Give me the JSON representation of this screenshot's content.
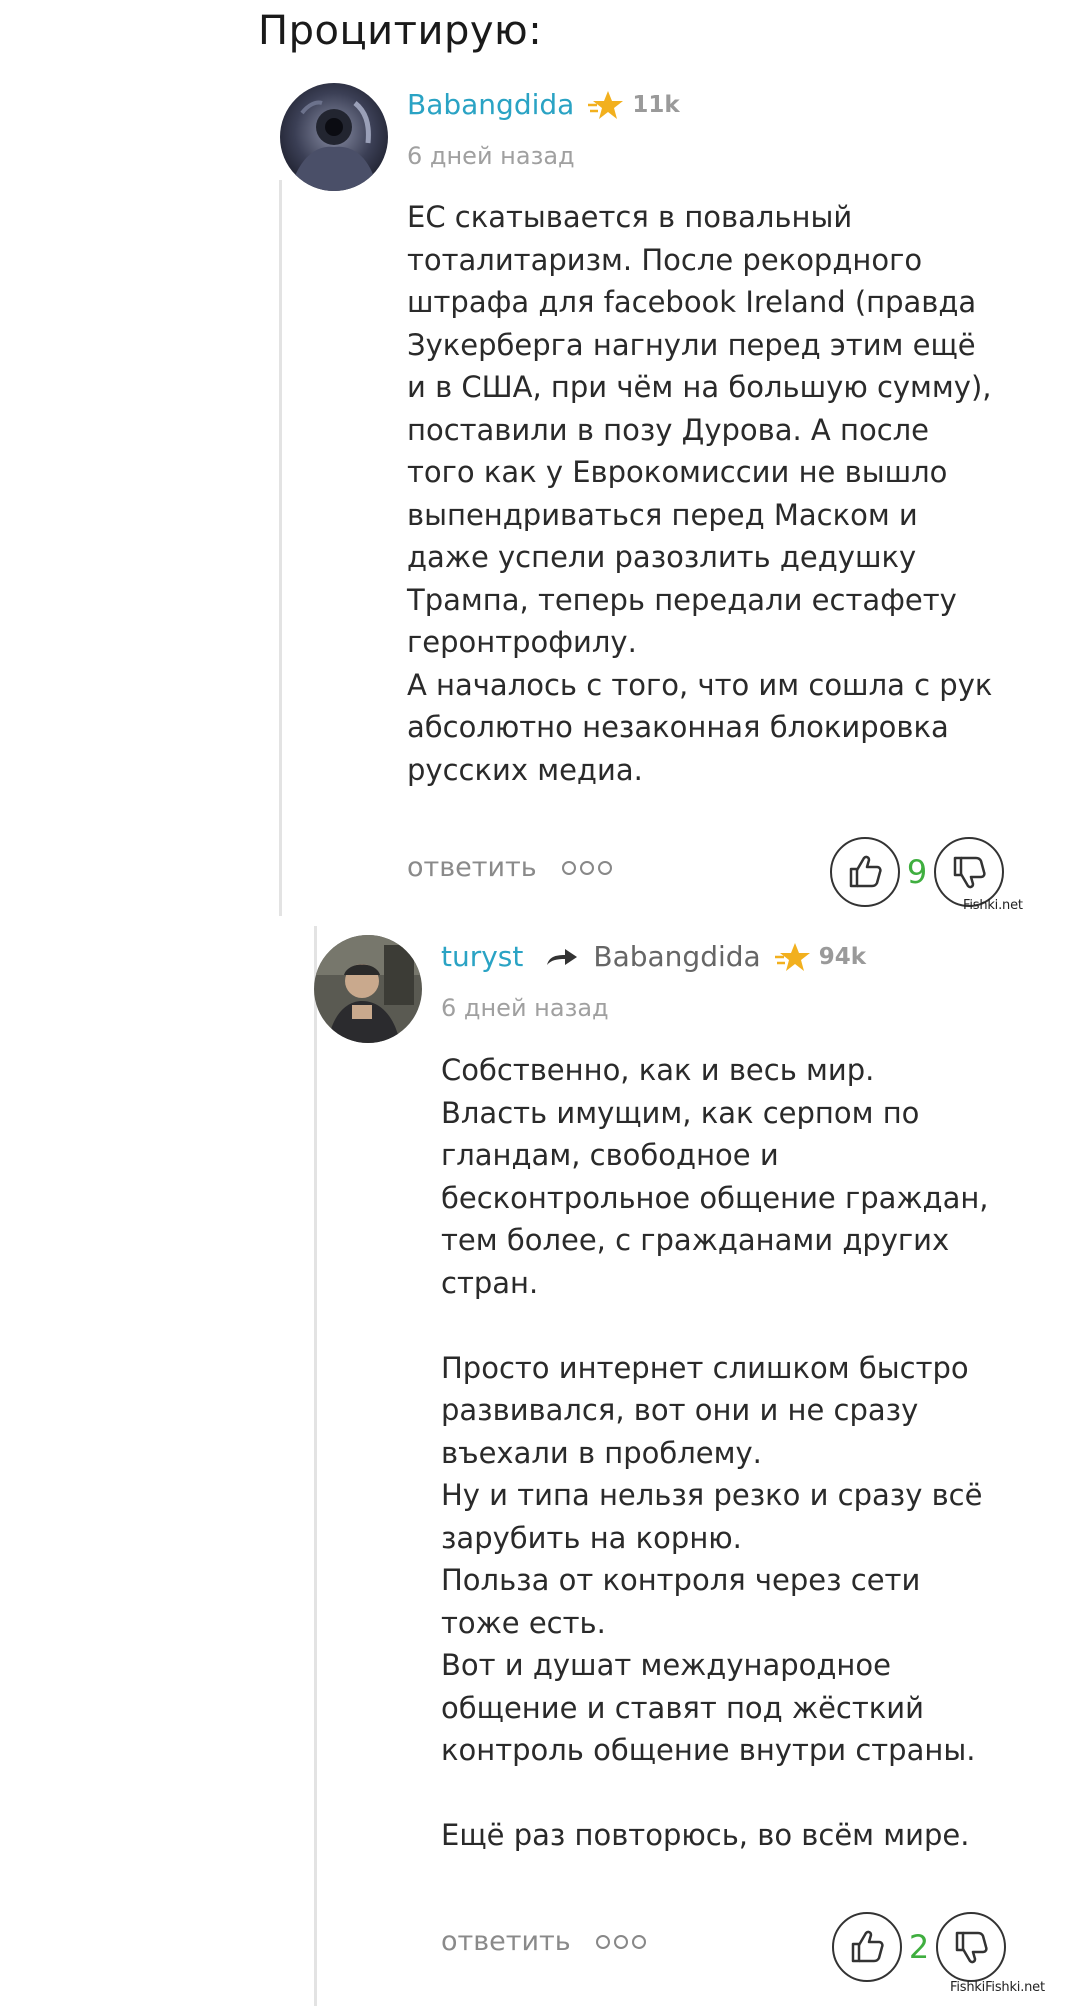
{
  "header": {
    "title": "Процитирую:"
  },
  "comments": [
    {
      "author": "Babangdida",
      "rating": "11k",
      "time": "6 дней назад",
      "body": "ЕС скатывается в повальный\nтоталитаризм. После рекордного\nштрафа для facebook Ireland (правда\nЗукерберга нагнули перед этим ещё\nи в США, при чём на большую сумму),\nпоставили в позу Дурова. А после\nтого как у Еврокомиссии не вышло\nвыпендриваться перед Маском и\nдаже успели разозлить дедушку\nТрампа, теперь передали естафету\nгеронтрофилу.\nА началось с того, что им сошла с рук\nабсолютно незаконная блокировка\nрусских медиа.",
      "reply_label": "ответить",
      "votes": "9"
    },
    {
      "author": "turyst",
      "reply_to": "Babangdida",
      "rating": "94k",
      "time": "6 дней назад",
      "body": "Собственно, как и весь мир.\nВласть имущим, как серпом по\nгландам, свободное и\nбесконтрольное общение граждан,\nтем более, с гражданами других\nстран.\n\nПросто интернет слишком быстро\nразвивался, вот они и не сразу\nвъехали в проблему.\nНу и типа нельзя резко и сразу всё\nзарубить на корню.\nПольза от контроля через сети\nтоже есть.\nВот и душат международное\nобщение и ставят под жёсткий\nконтроль общение внутри страны.\n\nЕщё раз повторюсь, во всём мире.",
      "reply_label": "ответить",
      "votes": "2"
    }
  ],
  "watermarks": [
    "Fishki.net",
    "FishkiFishki.net"
  ],
  "colors": {
    "author": "#2aa3c4",
    "votes_positive": "#3fae3f",
    "star": "#f2b01e"
  },
  "icons": [
    "user-avatar",
    "reply-arrow-icon",
    "star-icon",
    "more-dots-icon",
    "thumbs-up-icon",
    "thumbs-down-icon"
  ]
}
